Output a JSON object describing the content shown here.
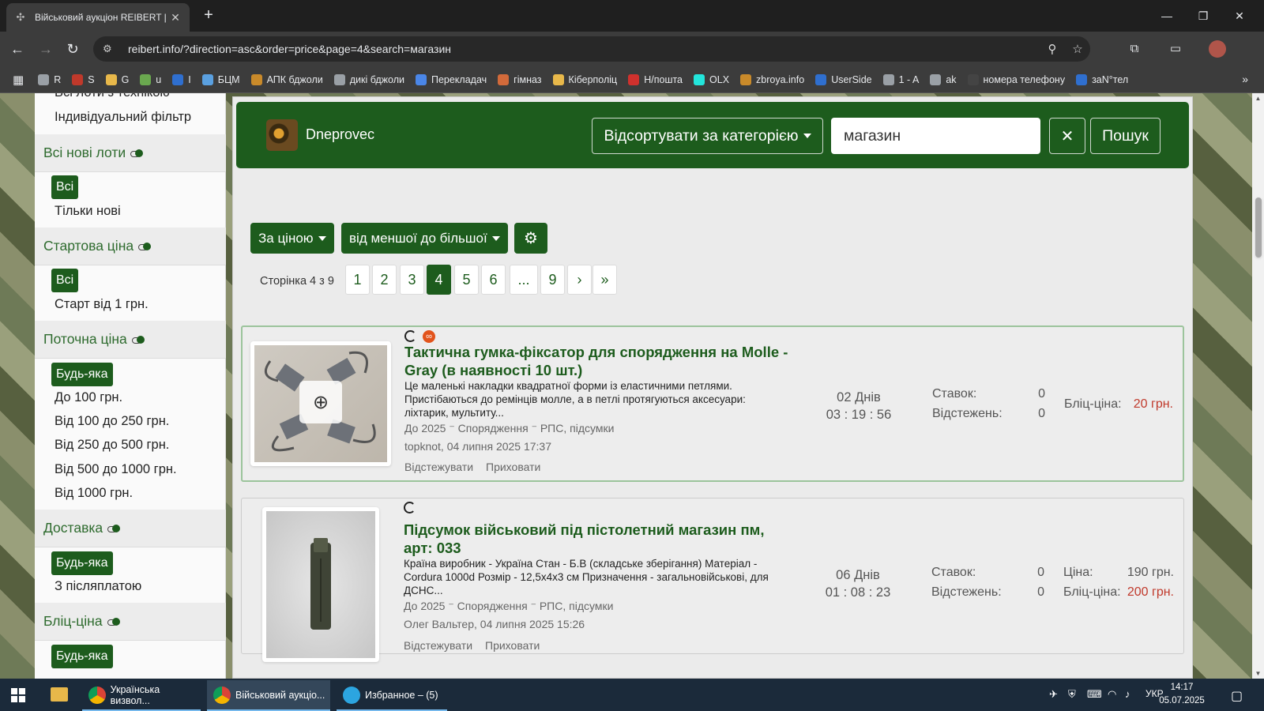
{
  "browser": {
    "tab_title": "Військовий аукціон REIBERT | F",
    "tab_close": "✕",
    "new_tab": "+",
    "url": "reibert.info/?direction=asc&order=price&page=4&search=магазин",
    "bookmarks": [
      {
        "label": "R",
        "color": "#9aa0a6"
      },
      {
        "label": "S",
        "color": "#c0392b"
      },
      {
        "label": "G",
        "color": "#e8b84a"
      },
      {
        "label": "u",
        "color": "#6aa84f"
      },
      {
        "label": "I",
        "color": "#2f6fcf"
      },
      {
        "label": "БЦМ",
        "color": "#5aa0e0"
      },
      {
        "label": "АПК бджоли",
        "color": "#c98a2a"
      },
      {
        "label": "дикі бджоли",
        "color": "#9aa0a6"
      },
      {
        "label": "Перекладач",
        "color": "#4a86e8"
      },
      {
        "label": "гімназ",
        "color": "#d26a3a"
      },
      {
        "label": "Кіберполіц",
        "color": "#e8b84a"
      },
      {
        "label": "Н/пошта",
        "color": "#d0312d"
      },
      {
        "label": "OLX",
        "color": "#23e5db"
      },
      {
        "label": "zbroya.info",
        "color": "#c98a2a"
      },
      {
        "label": "UserSide",
        "color": "#2f6fcf"
      },
      {
        "label": "1 - A",
        "color": "#9aa0a6"
      },
      {
        "label": "ak",
        "color": "#9aa0a6"
      },
      {
        "label": "номера телефону",
        "color": "#444"
      },
      {
        "label": "заN°тел",
        "color": "#2f6fcf"
      }
    ],
    "bookmarks_more": "»"
  },
  "sidebar": {
    "top_links": [
      "Всі лоти з технікою",
      "Індивідуальний фільтр"
    ],
    "sections": [
      {
        "heading": "Всі нові лоти",
        "pill": "Всі",
        "options": [
          "Тільки нові"
        ]
      },
      {
        "heading": "Стартова ціна",
        "pill": "Всі",
        "options": [
          "Старт від 1 грн."
        ]
      },
      {
        "heading": "Поточна ціна",
        "pill": "Будь-яка",
        "options": [
          "До 100 грн.",
          "Від 100 до 250 грн.",
          "Від 250 до 500 грн.",
          "Від 500 до 1000 грн.",
          "Від 1000 грн."
        ]
      },
      {
        "heading": "Доставка",
        "pill": "Будь-яка",
        "options": [
          "З післяплатою"
        ]
      },
      {
        "heading": "Бліц-ціна",
        "pill": "Будь-яка",
        "options": []
      }
    ]
  },
  "header": {
    "username": "Dneprovec",
    "category_button": "Відсортувати за категорією",
    "search_value": "магазин",
    "clear_button": "✕",
    "search_button": "Пошук"
  },
  "sorting": {
    "order_by": "За ціною",
    "direction": "від меншої до більшої"
  },
  "pagination": {
    "label": "Сторінка 4 з 9",
    "pages": [
      "1",
      "2",
      "3",
      "4",
      "5",
      "6",
      "...",
      "9",
      "›",
      "»"
    ],
    "current": "4"
  },
  "lots": [
    {
      "title": "Тактична гумка-фіксатор для спорядження на Molle - Gray (в наявності 10 шт.)",
      "description": "Це маленькі накладки квадратної форми із еластичними петлями. Пристібаються до ремінців молле, а в петлі протягуються аксесуари: ліхтарик, мультиту...",
      "category": "До 2025 ⁻ Спорядження ⁻ РПС, підсумки",
      "author": "topknot, 04 липня 2025 17:37",
      "time_days": "02 Днів",
      "time_clock": "03 : 19 : 56",
      "bids_label": "Ставок:",
      "bids": "0",
      "watch_label": "Відстежень:",
      "watchers": "0",
      "blitz_label": "Бліц-ціна:",
      "blitz": "20 грн.",
      "track": "Відстежувати",
      "hide": "Приховати"
    },
    {
      "title": "Підсумок військовий під пістолетний магазин пм, арт: 033",
      "description": "Країна виробник - Україна Стан - Б.В (складське зберігання) Матеріал - Cordura 1000d Розмір - 12,5х4х3 см Призначення - загальновійськові, для ДСНС...",
      "category": "До 2025 ⁻ Спорядження ⁻ РПС, підсумки",
      "author": "Олег Вальтер, 04 липня 2025 15:26",
      "time_days": "06 Днів",
      "time_clock": "01 : 08 : 23",
      "bids_label": "Ставок:",
      "bids": "0",
      "watch_label": "Відстежень:",
      "watchers": "0",
      "price_label": "Ціна:",
      "price": "190 грн.",
      "blitz_label": "Бліц-ціна:",
      "blitz": "200 грн.",
      "track": "Відстежувати",
      "hide": "Приховати"
    }
  ],
  "taskbar": {
    "apps": [
      "Українська визвол...",
      "Військовий аукціо...",
      "Избранное – (5)"
    ],
    "lang": "УКР",
    "time": "14:17",
    "date": "05.07.2025"
  },
  "colors": {
    "accent": "#1d5c1d",
    "price_red": "#c0392b"
  }
}
